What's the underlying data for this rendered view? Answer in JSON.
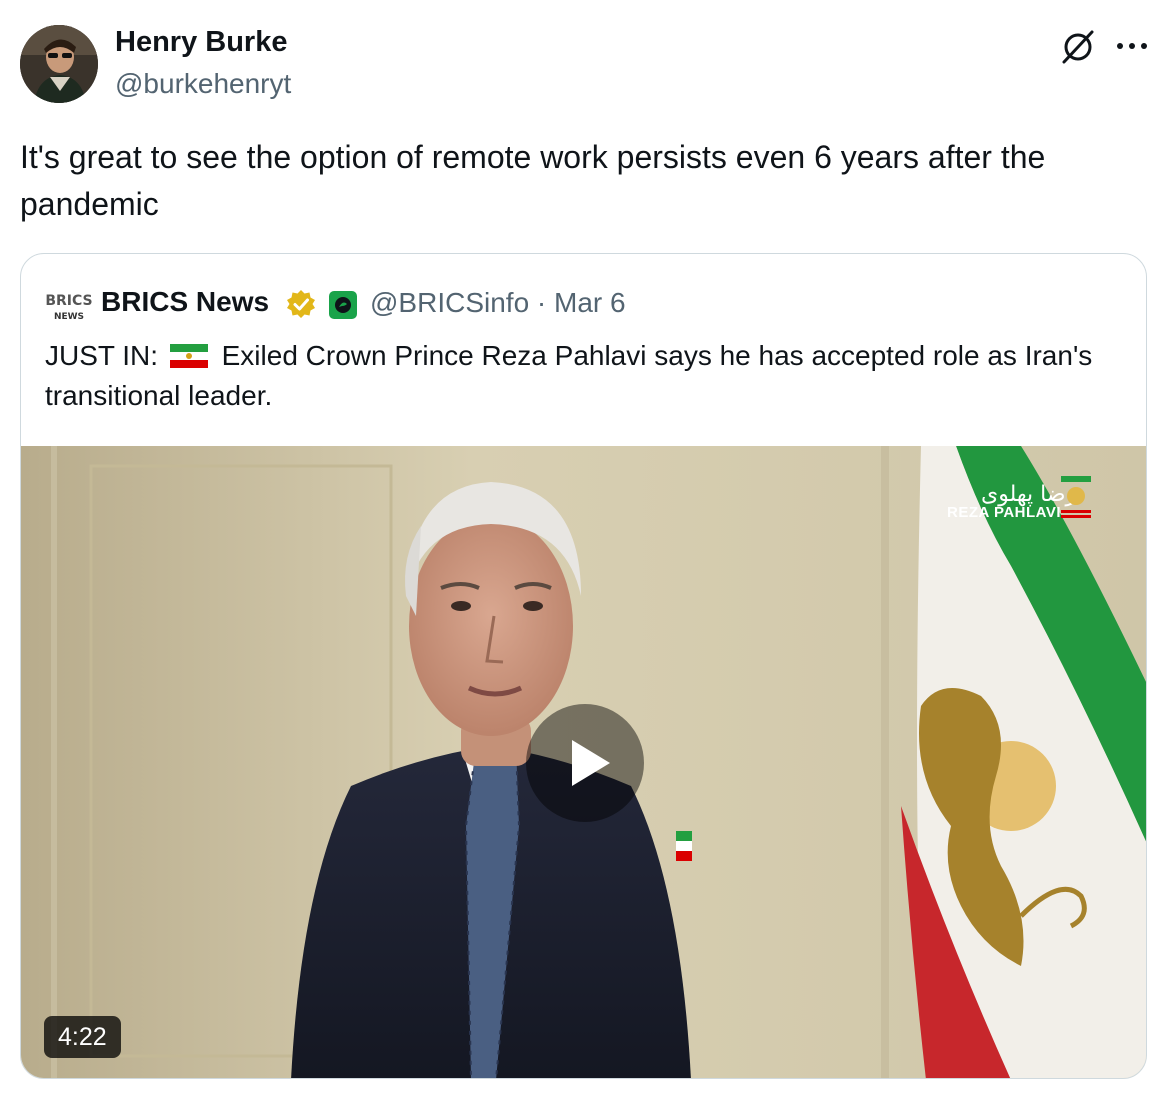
{
  "author": {
    "name": "Henry Burke",
    "handle": "@burkehenryt"
  },
  "tweet": {
    "text": "It's great to see the option of remote work persists even 6 years after the pandemic"
  },
  "quoted": {
    "logo_top": "BRICS",
    "logo_bottom": "NEWS",
    "name": "BRICS News",
    "handle_date": "@BRICSinfo · Mar 6",
    "text_prefix": "JUST IN:",
    "text_body": "Exiled Crown Prince Reza Pahlavi says he has accepted role as Iran's transitional leader.",
    "video": {
      "duration": "4:22",
      "watermark_fa": "رضا پهلوی",
      "watermark_en": "REZA PAHLAVI"
    }
  },
  "icons": {
    "grok": "grok-icon",
    "more": "more-horizontal-icon",
    "verified": "verified-badge-gold",
    "affiliate": "affiliate-badge",
    "play": "play-icon",
    "flag": "iran-lion-sun-flag-icon"
  },
  "colors": {
    "text": "#0f1419",
    "muted": "#536471",
    "border": "#cfd9de",
    "verified_gold": "#e2b719"
  }
}
